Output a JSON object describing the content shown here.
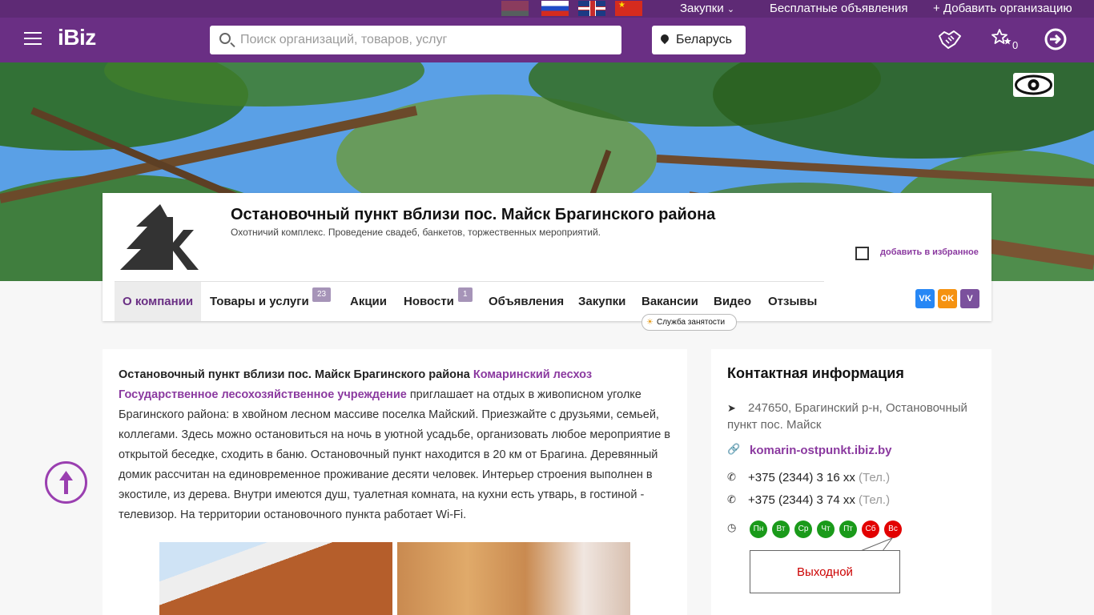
{
  "topbar": {
    "languages": [
      "BY",
      "RU",
      "EN",
      "CN"
    ],
    "purchases": "Закупки",
    "free_ads": "Бесплатные объявления",
    "add_org": "+ Добавить организацию"
  },
  "header": {
    "logo": "iBiz",
    "search_placeholder": "Поиск организаций, товаров, услуг",
    "region": "Беларусь",
    "favorites_count": "0"
  },
  "company": {
    "title": "Остановочный пункт вблизи пос. Майск Брагинского района",
    "subtitle": "Охотничий комплекс. Проведение свадеб, банкетов, торжественных мероприятий.",
    "favorite_label": "добавить в избранное"
  },
  "tabs": [
    {
      "label": "О компании"
    },
    {
      "label": "Товары и услуги",
      "badge": "23"
    },
    {
      "label": "Акции"
    },
    {
      "label": "Новости",
      "badge": "1"
    },
    {
      "label": "Объявления"
    },
    {
      "label": "Закупки"
    },
    {
      "label": "Вакансии"
    },
    {
      "label": "Видео"
    },
    {
      "label": "Отзывы"
    }
  ],
  "jobs_tooltip": "Служба занятости",
  "social": {
    "vk": "VK",
    "ok": "OK",
    "viber": "V"
  },
  "description": {
    "lead": "Остановочный пункт вблизи пос. Майск Брагинского района",
    "link1": "Комаринский лесхоз",
    "link2": "Государственное лесохозяйственное учреждение",
    "text": "приглашает на отдых в живописном уголке Брагинского района: в хвойном лесном массиве поселка Майский. Приезжайте с друзьями, семьей, коллегами. Здесь можно остановиться на ночь в уютной усадьбе, организовать любое мероприятие в открытой беседке, сходить в баню. Остановочный пункт находится в 20 км от Брагина. Деревянный домик рассчитан на единовременное проживание десяти человек. Интерьер строения выполнен в экостиле, из дерева. Внутри имеются душ, туалетная комната, на кухни есть утварь, в гостиной - телевизор. На территории остановочного пункта работает Wi-Fi."
  },
  "contacts": {
    "title": "Контактная информация",
    "address": "247650, Брагинский р-н, Остановочный пункт пос. Майск",
    "website": "komarin-ostpunkt.ibiz.by",
    "phones": [
      {
        "number": "+375 (2344) 3 16 xx",
        "type": "(Тел.)"
      },
      {
        "number": "+375 (2344) 3 74 xx",
        "type": "(Тел.)"
      }
    ],
    "days": [
      {
        "label": "Пн",
        "status": "work"
      },
      {
        "label": "Вт",
        "status": "work"
      },
      {
        "label": "Ср",
        "status": "work"
      },
      {
        "label": "Чт",
        "status": "work"
      },
      {
        "label": "Пт",
        "status": "work"
      },
      {
        "label": "Сб",
        "status": "off"
      },
      {
        "label": "Вс",
        "status": "off"
      }
    ],
    "day_off_label": "Выходной"
  }
}
